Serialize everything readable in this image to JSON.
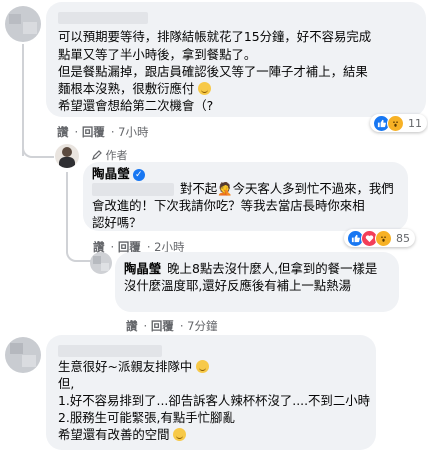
{
  "comment1": {
    "lines": [
      "可以預期要等待，排隊結帳就花了15分鐘，好不容易完成",
      "點單又等了半小時後，拿到餐點了。",
      "但是餐點漏掉，跟店員確認後又等了一陣子才補上，結果",
      "麵根本沒熟，很敷衍應付",
      "希望還會想給第二次機會（?"
    ],
    "actions": [
      "讚",
      "回覆",
      "7小時"
    ],
    "reaction_count": "11"
  },
  "reply1": {
    "author_label": "作者",
    "name": "陶晶瑩",
    "lines": [
      "對不起🤦今天客人多到忙不過來，我們",
      "會改進的！下次我請你吃？等我去當店長時你來相",
      "認好嗎？"
    ],
    "actions": [
      "讚",
      "回覆",
      "2小時"
    ],
    "reaction_count": "85"
  },
  "reply2": {
    "name": "陶晶瑩",
    "lines": [
      "晚上8點去沒什麼人,但拿到的餐一樣是",
      "沒什麼溫度耶,還好反應後有補上一點熱湯"
    ],
    "actions": [
      "讚",
      "回覆",
      "7分鐘"
    ]
  },
  "comment2": {
    "lines": [
      "生意很好~派親友排隊中",
      "但,",
      "1.好不容易排到了...卻告訴客人辣杯杯沒了....不到二小時",
      "2.服務生可能緊張,有點手忙腳亂",
      "希望還有改善的空間"
    ]
  },
  "icons": {
    "verified": "verified-badge-icon",
    "like": "like-icon",
    "love": "love-icon",
    "wow": "wow-icon"
  }
}
